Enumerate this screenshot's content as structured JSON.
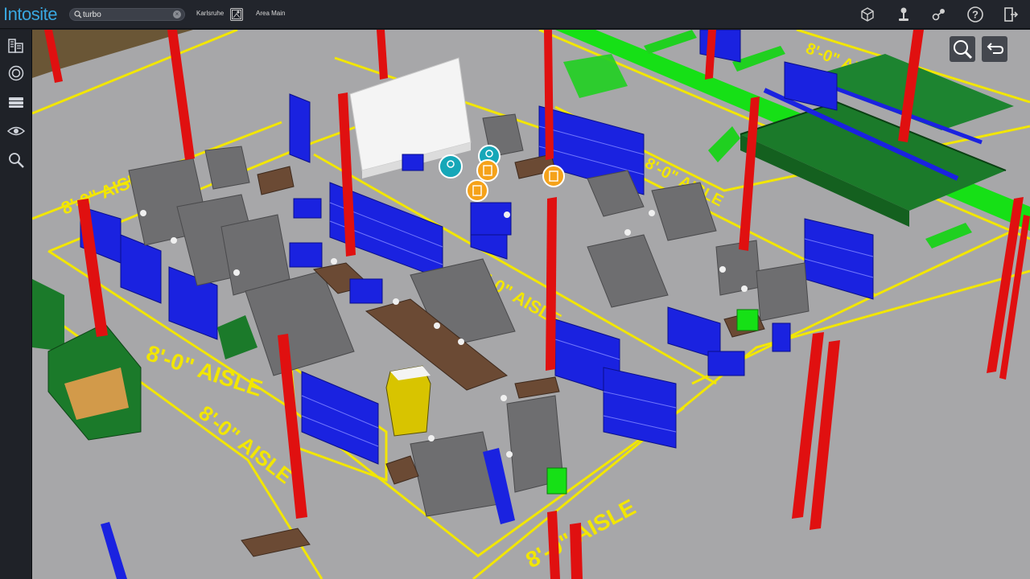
{
  "app": {
    "title": "Intosite"
  },
  "search": {
    "value": "turbo",
    "placeholder": ""
  },
  "location": {
    "city": "Karlsruhe",
    "site": "Area Main"
  },
  "toolbar": {
    "icons": [
      "cube-icon",
      "joystick-icon",
      "share-icon",
      "help-icon",
      "logout-icon"
    ]
  },
  "rail": {
    "icons": [
      "building-icon",
      "target-icon",
      "layers-icon",
      "eye-icon",
      "search-icon"
    ]
  },
  "scene": {
    "aisle_labels": [
      "8'-0\" AISLE",
      "8'-0\" AISLE",
      "8'-0\" AISLE",
      "8'-0\" AISLE",
      "8'-0\" AISLE",
      "8'-0\" AISLE",
      "8'-0\" AISLE"
    ],
    "colors": {
      "floor": "#a7a7a9",
      "aisle_line": "#f2e600",
      "column": "#e01010",
      "rack": "#1a22e0",
      "conveyor": "#16e016",
      "platform": "#1b7a2a",
      "machine": "#6e6e70",
      "bench": "#6b4a34",
      "poi_teal": "#16a7b8",
      "poi_orange": "#f5a21a"
    }
  }
}
